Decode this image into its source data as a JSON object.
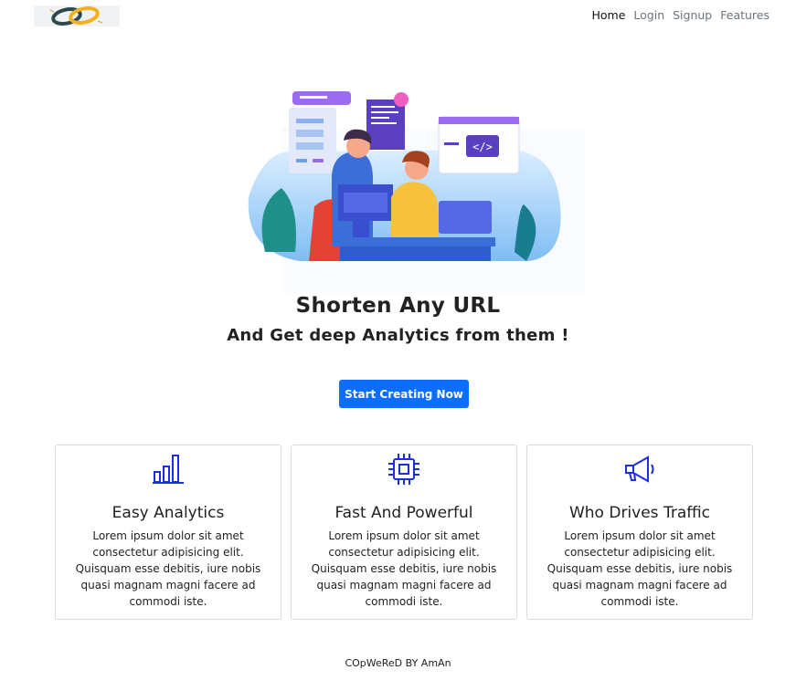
{
  "nav": {
    "links": [
      {
        "label": "Home",
        "active": true
      },
      {
        "label": "Login",
        "active": false
      },
      {
        "label": "Signup",
        "active": false
      },
      {
        "label": "Features",
        "active": false
      }
    ]
  },
  "hero": {
    "title": "Shorten Any URL",
    "subtitle": "And Get deep Analytics from them !",
    "cta_label": "Start Creating Now"
  },
  "features": [
    {
      "icon": "bar-chart-icon",
      "title": "Easy Analytics",
      "text": "Lorem ipsum dolor sit amet consectetur adipisicing elit. Quisquam esse debitis, iure nobis quasi magnam magni facere ad commodi iste."
    },
    {
      "icon": "cpu-chip-icon",
      "title": "Fast And Powerful",
      "text": "Lorem ipsum dolor sit amet consectetur adipisicing elit. Quisquam esse debitis, iure nobis quasi magnam magni facere ad commodi iste."
    },
    {
      "icon": "megaphone-icon",
      "title": "Who Drives Traffic",
      "text": "Lorem ipsum dolor sit amet consectetur adipisicing elit. Quisquam esse debitis, iure nobis quasi magnam magni facere ad commodi iste."
    }
  ],
  "footer": {
    "text": "COpWeReD BY AmAn"
  },
  "colors": {
    "accent": "#0d6efd",
    "icon": "#1a2ee6",
    "border": "#d9dcdf"
  }
}
